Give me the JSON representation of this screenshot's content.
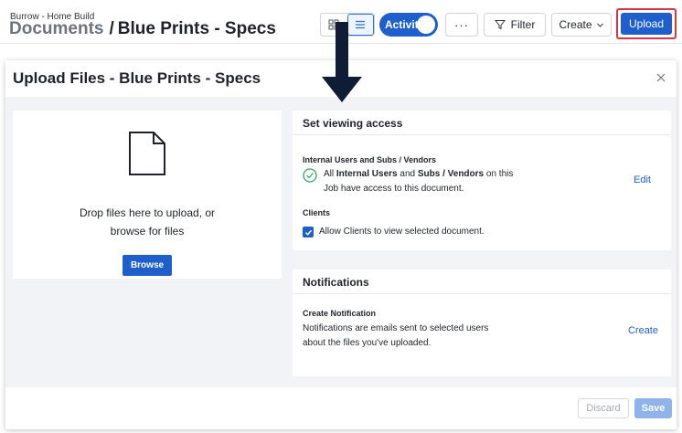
{
  "header": {
    "breadcrumb_small": "Burrow - Home Build",
    "breadcrumb_root": "Documents",
    "breadcrumb_separator": "/",
    "folder_title": "Blue Prints - Specs",
    "activity_label": "Activity",
    "more_label": "···",
    "filter_label": "Filter",
    "create_label": "Create",
    "upload_label": "Upload"
  },
  "modal": {
    "title": "Upload Files - Blue Prints - Specs",
    "drop_text_line1": "Drop files here to upload, or",
    "drop_text_line2": "browse for files",
    "browse_label": "Browse",
    "access": {
      "heading": "Set viewing access",
      "internal_heading": "Internal Users and Subs / Vendors",
      "internal_text_pre": "All ",
      "internal_text_b1": "Internal Users",
      "internal_text_mid": " and ",
      "internal_text_b2": "Subs / Vendors",
      "internal_text_post": " on this",
      "internal_text_line2": "Job have access to this document.",
      "edit_label": "Edit",
      "clients_heading": "Clients",
      "clients_checkbox_label": "Allow Clients to view selected document.",
      "clients_checked": true
    },
    "notifications": {
      "heading": "Notifications",
      "sub_heading": "Create Notification",
      "text_line1": "Notifications are emails sent to selected users",
      "text_line2": "about the files you've uploaded.",
      "create_label": "Create"
    },
    "footer": {
      "discard_label": "Discard",
      "save_label": "Save"
    }
  },
  "colors": {
    "primary": "#1e5fcc",
    "highlight_border": "#d93640",
    "disabled_primary": "#8fb3ea",
    "success_green": "#2fa66a",
    "arrow": "#0f1c35"
  },
  "icons": [
    "grid-view-icon",
    "list-view-icon",
    "filter-icon",
    "chevron-down-icon",
    "close-icon",
    "file-icon",
    "check-circle-icon",
    "checkbox-check-icon",
    "down-arrow-annotation"
  ]
}
